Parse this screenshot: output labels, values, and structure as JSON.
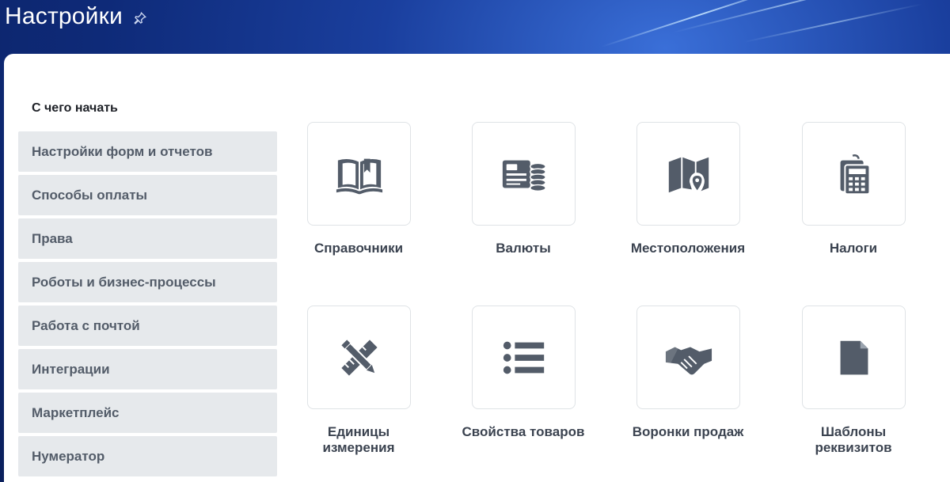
{
  "header": {
    "title": "Настройки",
    "pin_icon": "pin-icon"
  },
  "sidebar": {
    "heading": "С чего начать",
    "items": [
      {
        "label": "Настройки форм и отчетов"
      },
      {
        "label": "Способы оплаты"
      },
      {
        "label": "Права"
      },
      {
        "label": "Роботы и бизнес-процессы"
      },
      {
        "label": "Работа с почтой"
      },
      {
        "label": "Интеграции"
      },
      {
        "label": "Маркетплейс"
      },
      {
        "label": "Нумератор"
      }
    ]
  },
  "tiles": [
    {
      "label": "Справочники",
      "icon": "book-icon"
    },
    {
      "label": "Валюты",
      "icon": "currency-icon"
    },
    {
      "label": "Местоположения",
      "icon": "map-pin-icon"
    },
    {
      "label": "Налоги",
      "icon": "calculator-icon"
    },
    {
      "label": "Единицы измерения",
      "icon": "ruler-pencil-icon"
    },
    {
      "label": "Свойства товаров",
      "icon": "list-icon"
    },
    {
      "label": "Воронки продаж",
      "icon": "handshake-icon"
    },
    {
      "label": "Шаблоны реквизитов",
      "icon": "document-icon"
    }
  ],
  "colors": {
    "icon": "#535c69",
    "menu_bg": "#e6e9ec",
    "menu_text": "#535c69",
    "tile_border": "#dfe3e6"
  }
}
